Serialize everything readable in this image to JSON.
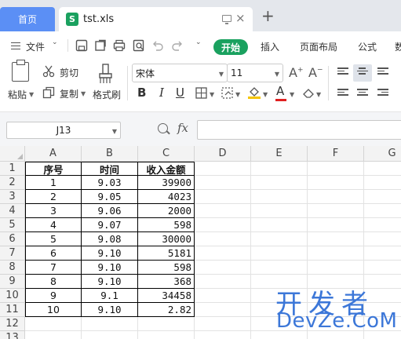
{
  "tabs": {
    "home_label": "首页",
    "file_icon_letter": "S",
    "file_name": "tst.xls",
    "new_tab_glyph": "+",
    "close_glyph": "×"
  },
  "menubar": {
    "file_label": "文件",
    "caret": "⌄",
    "start_label": "开始",
    "items": [
      "插入",
      "页面布局",
      "公式",
      "数"
    ]
  },
  "ribbon": {
    "paste_label": "粘贴",
    "cut_label": "剪切",
    "copy_label": "复制",
    "format_painter_label": "格式刷",
    "font_name": "宋体",
    "font_size": "11",
    "bold": "B",
    "italic": "I",
    "underline": "U",
    "font_color_glyph": "A"
  },
  "formula": {
    "name_box": "J13",
    "fx": "fx",
    "value": ""
  },
  "sheet": {
    "columns": [
      "A",
      "B",
      "C",
      "D",
      "E",
      "F",
      "G"
    ],
    "rows": [
      "1",
      "2",
      "3",
      "4",
      "5",
      "6",
      "7",
      "8",
      "9",
      "10",
      "11",
      "12",
      "13"
    ],
    "header": [
      "序号",
      "时间",
      "收入金额"
    ],
    "data": [
      [
        "1",
        "9.03",
        "39900"
      ],
      [
        "2",
        "9.05",
        "4023"
      ],
      [
        "3",
        "9.06",
        "2000"
      ],
      [
        "4",
        "9.07",
        "598"
      ],
      [
        "5",
        "9.08",
        "30000"
      ],
      [
        "6",
        "9.10",
        "5181"
      ],
      [
        "7",
        "9.10",
        "598"
      ],
      [
        "8",
        "9.10",
        "368"
      ],
      [
        "9",
        "9.1",
        "34458"
      ],
      [
        "10",
        "9.10",
        "2.82"
      ]
    ]
  },
  "watermark": {
    "line1": "开发者",
    "line2": "DevZe.CoM"
  },
  "colors": {
    "tab_active": "#5b8ff5",
    "accent_green": "#1aa15f",
    "watermark": "#3c77d8"
  }
}
